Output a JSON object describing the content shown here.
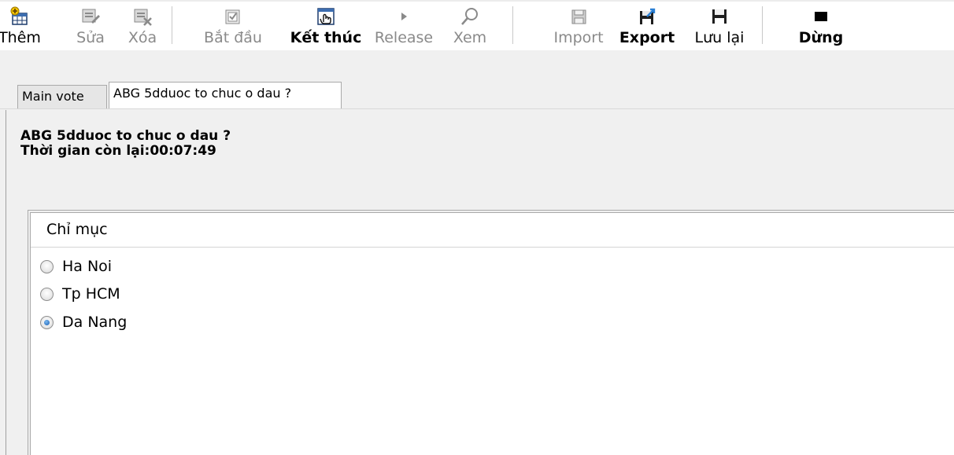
{
  "toolbar": {
    "buttons": [
      {
        "label": "Thêm",
        "icon": "add-icon",
        "enabled": true
      },
      {
        "label": "Sửa",
        "icon": "edit-icon",
        "enabled": false
      },
      {
        "label": "Xóa",
        "icon": "delete-icon",
        "enabled": false
      },
      {
        "label": "Bắt đầu",
        "icon": "start-icon",
        "enabled": false
      },
      {
        "label": "Kết thúc",
        "icon": "finish-icon",
        "enabled": true
      },
      {
        "label": "Release",
        "icon": "play-icon",
        "enabled": false
      },
      {
        "label": "Xem",
        "icon": "search-icon",
        "enabled": false
      },
      {
        "label": "Import",
        "icon": "import-icon",
        "enabled": false
      },
      {
        "label": "Export",
        "icon": "export-icon",
        "enabled": true
      },
      {
        "label": "Lưu lại",
        "icon": "save-icon",
        "enabled": true
      },
      {
        "label": "Dừng",
        "icon": "stop-icon",
        "enabled": true
      }
    ]
  },
  "tabs": [
    {
      "label": "Main vote",
      "active": false
    },
    {
      "label": "ABG 5dduoc to chuc o dau ?",
      "active": true
    }
  ],
  "vote": {
    "question": "ABG 5dduoc to chuc o dau ?",
    "time_remaining": "Thời gian còn lại:00:07:49"
  },
  "options_group": {
    "title": "Chỉ mục",
    "options": [
      {
        "label": "Ha Noi",
        "selected": false
      },
      {
        "label": "Tp HCM",
        "selected": false
      },
      {
        "label": "Da Nang",
        "selected": true
      }
    ]
  },
  "colors": {
    "accent": "#1a5fb4",
    "panel_bg": "#f0f0f0"
  }
}
